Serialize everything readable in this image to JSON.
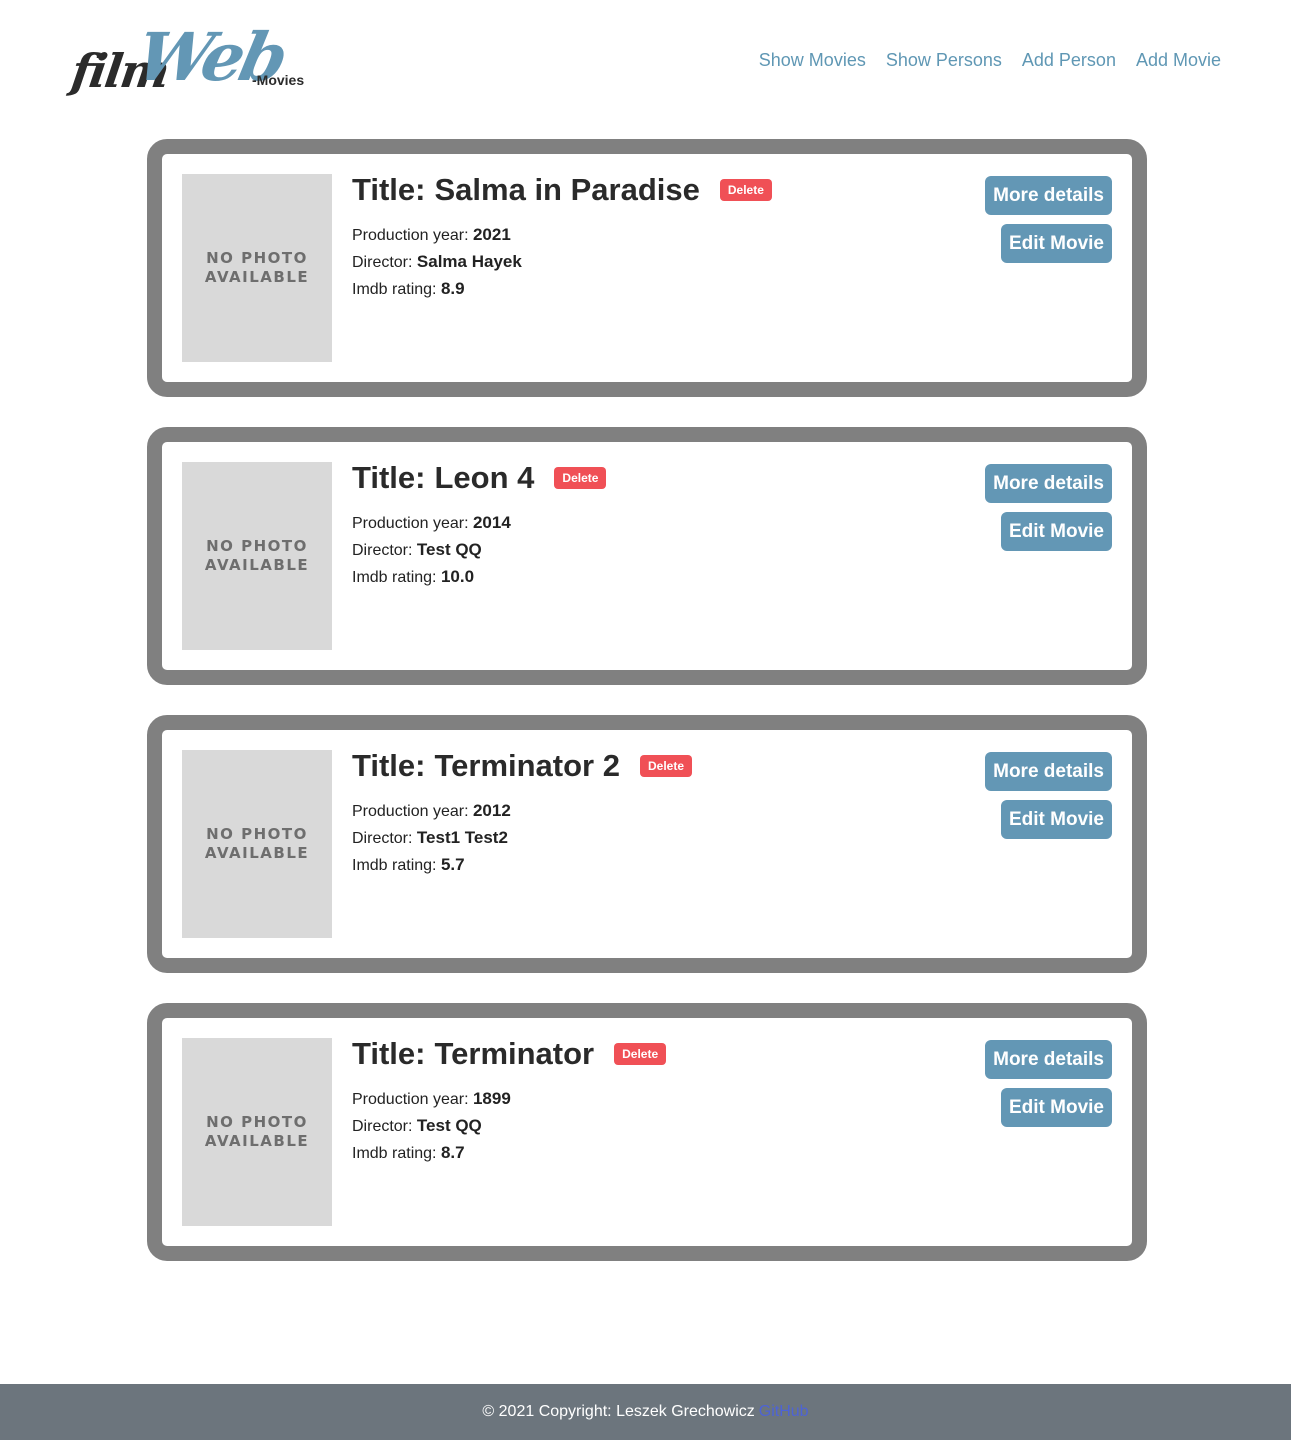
{
  "header": {
    "logo": {
      "film": "film",
      "web": "Web",
      "suffix": "-Movies"
    },
    "nav": [
      {
        "label": "Show Movies"
      },
      {
        "label": "Show Persons"
      },
      {
        "label": "Add Person"
      },
      {
        "label": "Add Movie"
      }
    ]
  },
  "labels": {
    "title_prefix": "Title:",
    "production_year": "Production year:",
    "director": "Director:",
    "rating": "Imdb rating:",
    "delete": "Delete",
    "more_details": "More details",
    "edit_movie": "Edit Movie",
    "no_photo": "NO PHOTO\nAVAILABLE"
  },
  "movies": [
    {
      "title": "Salma in Paradise",
      "year": "2021",
      "director": "Salma Hayek",
      "rating": "8.9"
    },
    {
      "title": "Leon 4",
      "year": "2014",
      "director": "Test QQ",
      "rating": "10.0"
    },
    {
      "title": "Terminator 2",
      "year": "2012",
      "director": "Test1 Test2",
      "rating": "5.7"
    },
    {
      "title": "Terminator",
      "year": "1899",
      "director": "Test QQ",
      "rating": "8.7"
    }
  ],
  "footer": {
    "copyright": "© 2021 Copyright: Leszek Grechowicz",
    "link_label": "GitHub"
  },
  "colors": {
    "accent": "#6397b5",
    "delete": "#f05056",
    "card_border": "#808080",
    "footer_bg": "#6c757d"
  }
}
